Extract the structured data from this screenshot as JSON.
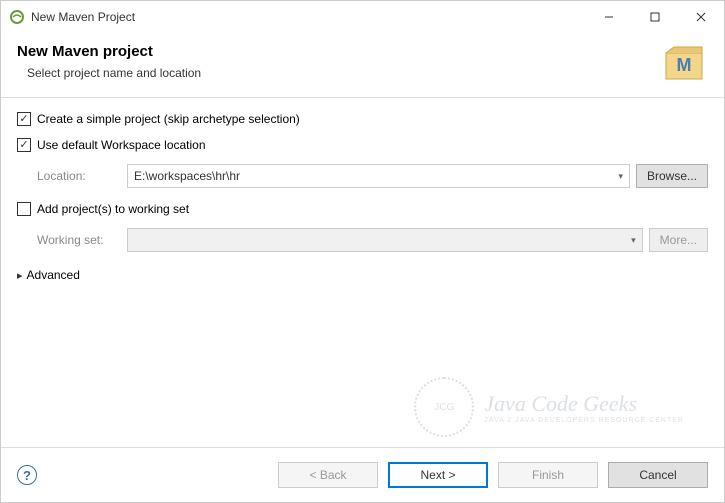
{
  "window": {
    "title": "New Maven Project"
  },
  "header": {
    "title": "New Maven project",
    "subtitle": "Select project name and location"
  },
  "options": {
    "simple_project": {
      "label": "Create a simple project (skip archetype selection)",
      "checked": true
    },
    "default_workspace": {
      "label": "Use default Workspace location",
      "checked": true
    },
    "location_label": "Location:",
    "location_value": "E:\\workspaces\\hr\\hr",
    "browse_label": "Browse...",
    "working_set_chk": {
      "label": "Add project(s) to working set",
      "checked": false
    },
    "working_set_label": "Working set:",
    "working_set_value": "",
    "more_label": "More...",
    "advanced_label": "Advanced"
  },
  "watermark": {
    "badge": "JCG",
    "main": "Java Code Geeks",
    "sub": "JAVA 2 JAVA DEVELOPERS RESOURCE CENTER"
  },
  "footer": {
    "back": "< Back",
    "next": "Next >",
    "finish": "Finish",
    "cancel": "Cancel"
  }
}
